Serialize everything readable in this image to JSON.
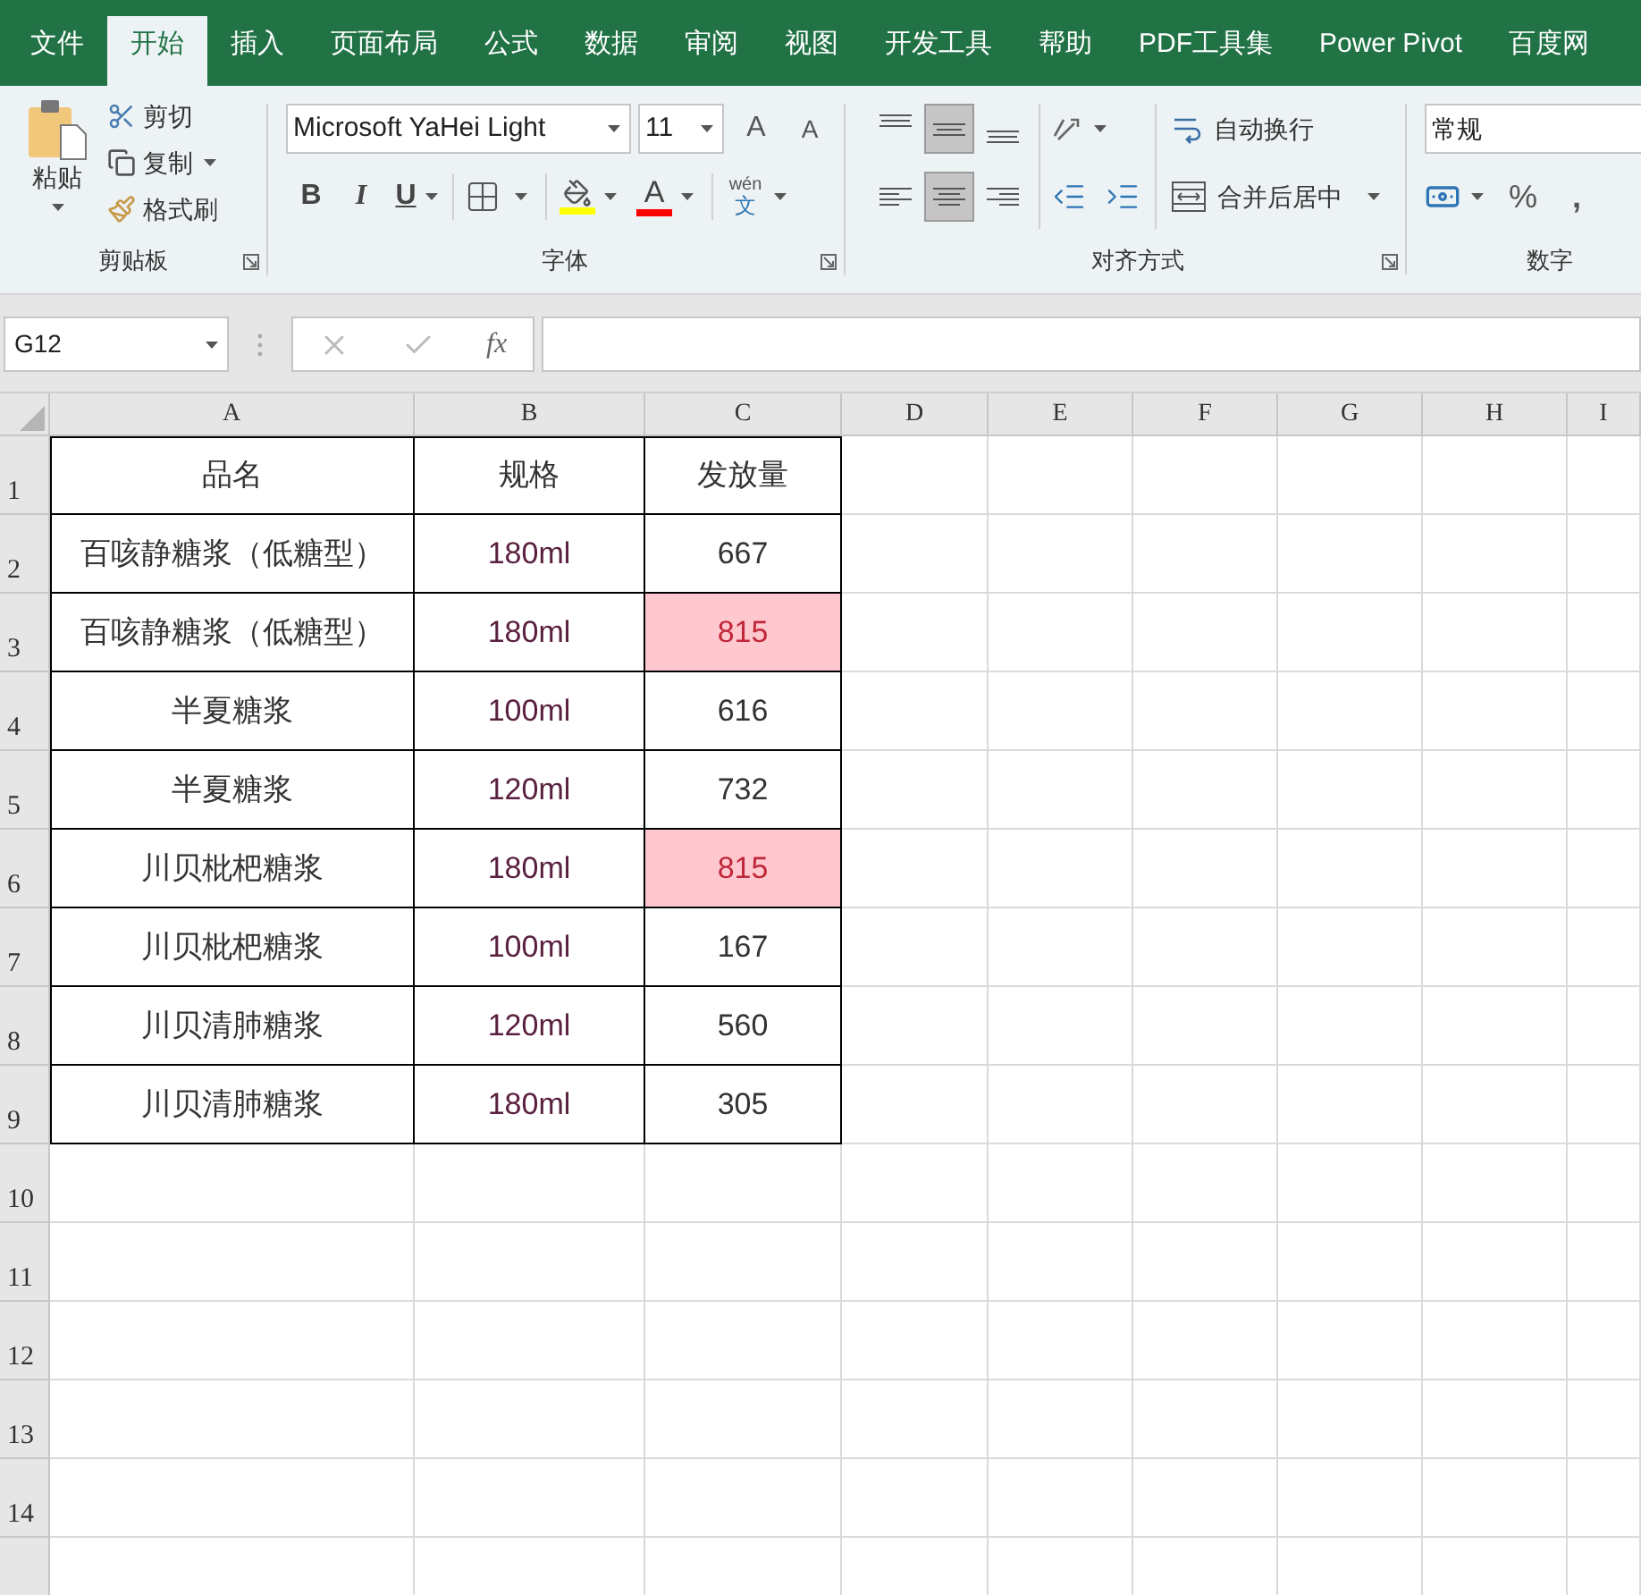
{
  "tabs": [
    {
      "label": "文件",
      "selected": false
    },
    {
      "label": "开始",
      "selected": true
    },
    {
      "label": "插入",
      "selected": false
    },
    {
      "label": "页面布局",
      "selected": false
    },
    {
      "label": "公式",
      "selected": false
    },
    {
      "label": "数据",
      "selected": false
    },
    {
      "label": "审阅",
      "selected": false
    },
    {
      "label": "视图",
      "selected": false
    },
    {
      "label": "开发工具",
      "selected": false
    },
    {
      "label": "帮助",
      "selected": false
    },
    {
      "label": "PDF工具集",
      "selected": false
    },
    {
      "label": "Power Pivot",
      "selected": false
    },
    {
      "label": "百度网",
      "selected": false
    }
  ],
  "clipboard": {
    "paste": "粘贴",
    "cut": "剪切",
    "copy": "复制",
    "format_painter": "格式刷",
    "group_label": "剪贴板"
  },
  "font": {
    "font_name": "Microsoft YaHei Light",
    "font_size": "11",
    "grow_glyph": "A",
    "shrink_glyph": "A",
    "bold": "B",
    "italic": "I",
    "underline": "U",
    "font_color_glyph": "A",
    "phonetic_pinyin": "wén",
    "phonetic_char": "文",
    "group_label": "字体"
  },
  "alignment": {
    "vertical": [
      {
        "kind": "top",
        "selected": false
      },
      {
        "kind": "middle",
        "selected": true
      },
      {
        "kind": "bottom",
        "selected": false
      }
    ],
    "horizontal": [
      {
        "kind": "left",
        "selected": false
      },
      {
        "kind": "center",
        "selected": true
      },
      {
        "kind": "right",
        "selected": false
      }
    ],
    "wrap_text": "自动换行",
    "merge_center": "合并后居中",
    "group_label": "对齐方式"
  },
  "number": {
    "format": "常规",
    "percent": "%",
    "comma": ",",
    "group_label": "数字"
  },
  "formula_bar": {
    "name_box": "G12",
    "fx": "fx"
  },
  "columns": [
    "A",
    "B",
    "C",
    "D",
    "E",
    "F",
    "G",
    "H",
    "I"
  ],
  "row_numbers": [
    "1",
    "2",
    "3",
    "4",
    "5",
    "6",
    "7",
    "8",
    "9",
    "10",
    "11",
    "12",
    "13",
    "14"
  ],
  "table": {
    "header": [
      "品名",
      "规格",
      "发放量"
    ],
    "rows": [
      {
        "name": "百咳静糖浆（低糖型）",
        "spec": "180ml",
        "amount": "667",
        "highlighted": false
      },
      {
        "name": "百咳静糖浆（低糖型）",
        "spec": "180ml",
        "amount": "815",
        "highlighted": true
      },
      {
        "name": "半夏糖浆",
        "spec": "100ml",
        "amount": "616",
        "highlighted": false
      },
      {
        "name": "半夏糖浆",
        "spec": "120ml",
        "amount": "732",
        "highlighted": false
      },
      {
        "name": "川贝枇杷糖浆",
        "spec": "180ml",
        "amount": "815",
        "highlighted": true
      },
      {
        "name": "川贝枇杷糖浆",
        "spec": "100ml",
        "amount": "167",
        "highlighted": false
      },
      {
        "name": "川贝清肺糖浆",
        "spec": "120ml",
        "amount": "560",
        "highlighted": false
      },
      {
        "name": "川贝清肺糖浆",
        "spec": "180ml",
        "amount": "305",
        "highlighted": false
      }
    ]
  }
}
